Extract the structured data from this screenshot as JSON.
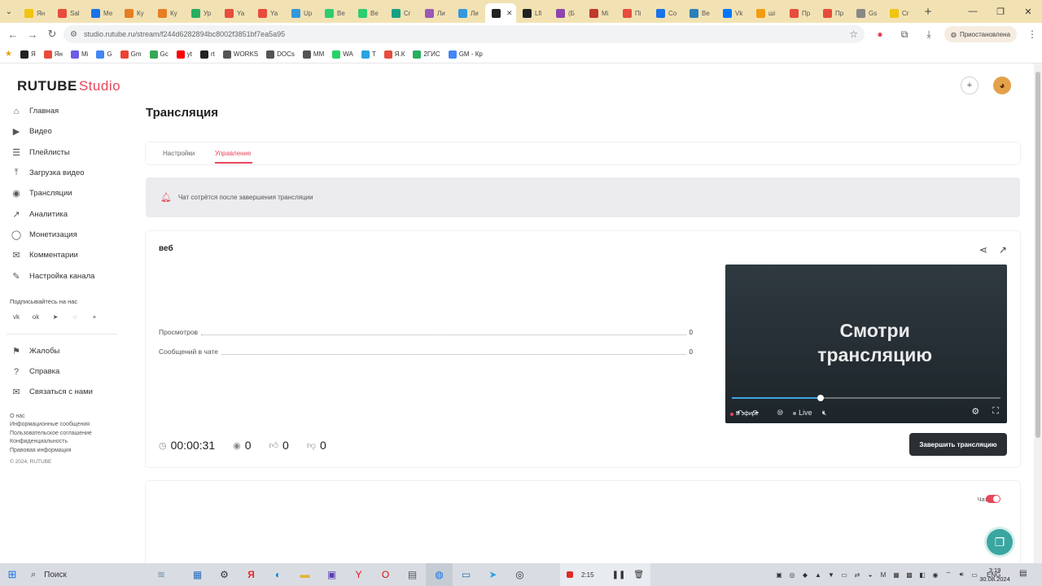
{
  "browser": {
    "tabs": [
      {
        "label": "Ян",
        "color": "#f1c40f"
      },
      {
        "label": "Sal",
        "color": "#e74c3c"
      },
      {
        "label": "Ме",
        "color": "#1a73e8"
      },
      {
        "label": "Ку",
        "color": "#e67e22"
      },
      {
        "label": "Ку",
        "color": "#e67e22"
      },
      {
        "label": "Ур",
        "color": "#27ae60"
      },
      {
        "label": "Ya",
        "color": "#e74c3c"
      },
      {
        "label": "Ya",
        "color": "#e74c3c"
      },
      {
        "label": "Up",
        "color": "#3498db"
      },
      {
        "label": "Be",
        "color": "#2ecc71"
      },
      {
        "label": "Be",
        "color": "#2ecc71"
      },
      {
        "label": "Cr",
        "color": "#16a085"
      },
      {
        "label": "Ли",
        "color": "#9b59b6"
      },
      {
        "label": "Ли",
        "color": "#3498db"
      }
    ],
    "active_tab_label": "",
    "tabs_after": [
      {
        "label": "Lfi",
        "color": "#222222"
      },
      {
        "label": "(Б",
        "color": "#8e44ad"
      },
      {
        "label": "Мі",
        "color": "#c0392b"
      },
      {
        "label": "Пі",
        "color": "#e74c3c"
      },
      {
        "label": "Со",
        "color": "#1a73e8"
      },
      {
        "label": "Ве",
        "color": "#2980b9"
      },
      {
        "label": "Vk",
        "color": "#0077ff"
      },
      {
        "label": "ші",
        "color": "#f39c12"
      },
      {
        "label": "Пр",
        "color": "#e74c3c"
      },
      {
        "label": "Пр",
        "color": "#e74c3c"
      },
      {
        "label": "Gs",
        "color": "#888888"
      },
      {
        "label": "Cr",
        "color": "#f1c40f"
      }
    ],
    "url": "studio.rutube.ru/stream/f244d6282894bc8002f3851bf7ea5a95",
    "paused_label": "Приостановлена",
    "bookmarks": [
      {
        "label": "Я",
        "color": "#222222"
      },
      {
        "label": "Ян",
        "color": "#e74c3c"
      },
      {
        "label": "Mi",
        "color": "#6c5ce7"
      },
      {
        "label": "G",
        "color": "#4285f4"
      },
      {
        "label": "Gm",
        "color": "#ea4335"
      },
      {
        "label": "Gc",
        "color": "#34a853"
      },
      {
        "label": "yt",
        "color": "#ff0000"
      },
      {
        "label": "rt",
        "color": "#222222"
      },
      {
        "label": "WORKS",
        "color": "#555555"
      },
      {
        "label": "DOCs",
        "color": "#555555"
      },
      {
        "label": "MM",
        "color": "#555555"
      },
      {
        "label": "WA",
        "color": "#25d366"
      },
      {
        "label": "T",
        "color": "#2aa3e0"
      },
      {
        "label": "Я.К",
        "color": "#e74c3c"
      },
      {
        "label": "2ГИС",
        "color": "#27ae60"
      },
      {
        "label": "GM - Кр",
        "color": "#4285f4"
      }
    ]
  },
  "app": {
    "logo_main": "RUTUBE",
    "logo_sub": "Studio",
    "page_title": "Трансляция"
  },
  "sidebar": {
    "items": [
      {
        "label": "Главная",
        "icon": "⌂"
      },
      {
        "label": "Видео",
        "icon": "▶"
      },
      {
        "label": "Плейлисты",
        "icon": "☰"
      },
      {
        "label": "Загрузка видео",
        "icon": "⤒"
      },
      {
        "label": "Трансляции",
        "icon": "◉"
      },
      {
        "label": "Аналитика",
        "icon": "↗"
      },
      {
        "label": "Монетизация",
        "icon": "◯"
      },
      {
        "label": "Комментарии",
        "icon": "✉"
      },
      {
        "label": "Настройка канала",
        "icon": "✎"
      }
    ],
    "subscribe_heading": "Подписывайтесь на нас",
    "bottom_items": [
      {
        "label": "Жалобы",
        "icon": "⚑"
      },
      {
        "label": "Справка",
        "icon": "?"
      },
      {
        "label": "Связаться с нами",
        "icon": "✉"
      }
    ],
    "footer_links": [
      "О нас",
      "Информационные сообщения",
      "Пользовательское соглашение",
      "Конфиденциальность",
      "Правовая информация"
    ],
    "copyright": "© 2024, RUTUBE"
  },
  "page_tabs": {
    "settings": "Настройки",
    "management": "Управление"
  },
  "alert": {
    "text": "Чат сотрётся после завершения трансляции"
  },
  "stream": {
    "name": "веб",
    "stats": [
      {
        "label": "Просмотров",
        "value": "0"
      },
      {
        "label": "Сообщений в чате",
        "value": "0"
      }
    ],
    "player": {
      "line1": "Смотри",
      "line2": "трансляцию",
      "on_air": "В эфире",
      "live": "Live",
      "progress": 0.33
    },
    "duration": "00:00:31",
    "viewers": "0",
    "likes": "0",
    "dislikes": "0",
    "end_button": "Завершить трансляцию"
  },
  "chat": {
    "label": "Чат",
    "enabled": true
  },
  "taskbar": {
    "search": "Поиск",
    "rec_time": "2:15",
    "lang": "ENG",
    "time": "3:19",
    "date": "30.08.2024"
  },
  "colors": {
    "accent": "#e8465b",
    "dark_button": "#2a2f33",
    "help_fab": "#3aa6a0"
  }
}
